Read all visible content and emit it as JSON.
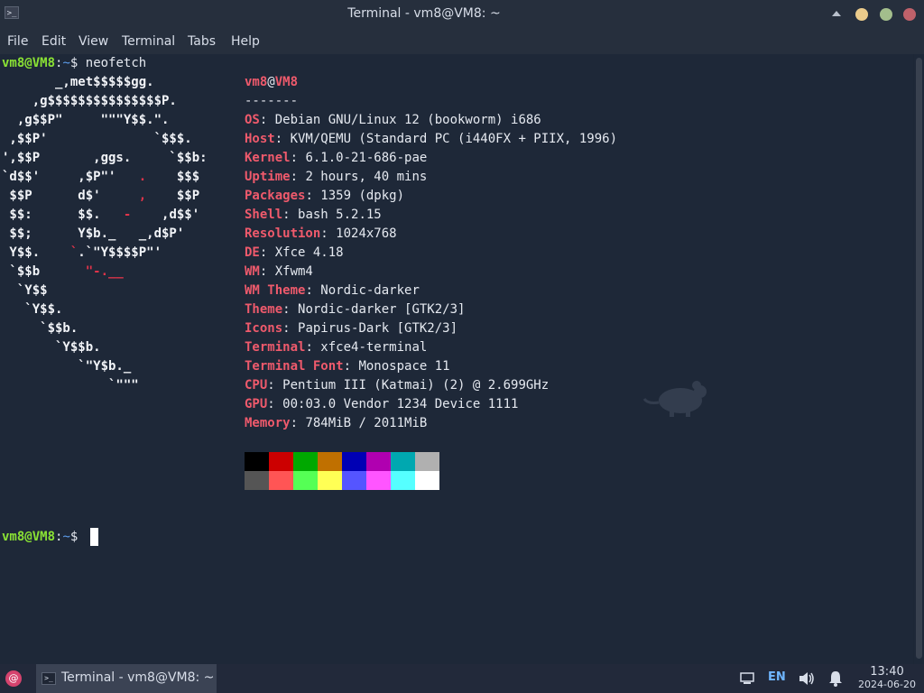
{
  "window": {
    "title": "Terminal - vm8@VM8: ~",
    "app_icon": ">_"
  },
  "menu": [
    "File",
    "Edit",
    "View",
    "Terminal",
    "Tabs",
    "Help"
  ],
  "prompt": {
    "user_host": "vm8@VM8",
    "sep": ":",
    "path": "~",
    "symbol": "$",
    "command": "neofetch"
  },
  "ascii_art": [
    "       _,met$$$$$gg.",
    "    ,g$$$$$$$$$$$$$$$P.",
    "  ,g$$P\"     \"\"\"Y$$.\".",
    " ,$$P'              `$$$.",
    "',$$P       ,ggs.     `$$b:",
    "`d$$'     ,$P\"'   .    $$$",
    " $$P      d$'     ,    $$P",
    " $$:      $$.   -    ,d$$'",
    " $$;      Y$b._   _,d$P'",
    " Y$$.    `.`\"Y$$$$P\"'",
    " `$$b      \"-.__",
    "  `Y$$",
    "   `Y$$.",
    "     `$$b.",
    "       `Y$$b.",
    "          `\"Y$b._",
    "              `\"\"\""
  ],
  "info": {
    "user": "vm8",
    "at": "@",
    "host": "VM8",
    "separator": "-------",
    "fields": [
      {
        "key": "OS",
        "value": "Debian GNU/Linux 12 (bookworm) i686"
      },
      {
        "key": "Host",
        "value": "KVM/QEMU (Standard PC (i440FX + PIIX, 1996)"
      },
      {
        "key": "Kernel",
        "value": "6.1.0-21-686-pae"
      },
      {
        "key": "Uptime",
        "value": "2 hours, 40 mins"
      },
      {
        "key": "Packages",
        "value": "1359 (dpkg)"
      },
      {
        "key": "Shell",
        "value": "bash 5.2.15"
      },
      {
        "key": "Resolution",
        "value": "1024x768"
      },
      {
        "key": "DE",
        "value": "Xfce 4.18"
      },
      {
        "key": "WM",
        "value": "Xfwm4"
      },
      {
        "key": "WM Theme",
        "value": "Nordic-darker"
      },
      {
        "key": "Theme",
        "value": "Nordic-darker [GTK2/3]"
      },
      {
        "key": "Icons",
        "value": "Papirus-Dark [GTK2/3]"
      },
      {
        "key": "Terminal",
        "value": "xfce4-terminal"
      },
      {
        "key": "Terminal Font",
        "value": "Monospace 11"
      },
      {
        "key": "CPU",
        "value": "Pentium III (Katmai) (2) @ 2.699GHz"
      },
      {
        "key": "GPU",
        "value": "00:03.0 Vendor 1234 Device 1111"
      },
      {
        "key": "Memory",
        "value": "784MiB / 2011MiB"
      }
    ]
  },
  "palette": {
    "normal": [
      "#000000",
      "#cc0000",
      "#00a800",
      "#c07000",
      "#0000b4",
      "#b000b0",
      "#00a8b0",
      "#b0b0b0"
    ],
    "bright": [
      "#555555",
      "#ff5555",
      "#55ff55",
      "#ffff55",
      "#5555ff",
      "#ff55ff",
      "#55ffff",
      "#ffffff"
    ]
  },
  "taskbar": {
    "task_label": "Terminal - vm8@VM8: ~",
    "keyboard_layout": "EN",
    "time": "13:40",
    "date": "2024-06-20"
  },
  "icons": {
    "menu": "debian-swirl-icon",
    "network": "network-wired-icon",
    "volume": "speaker-icon",
    "notifications": "bell-icon"
  }
}
